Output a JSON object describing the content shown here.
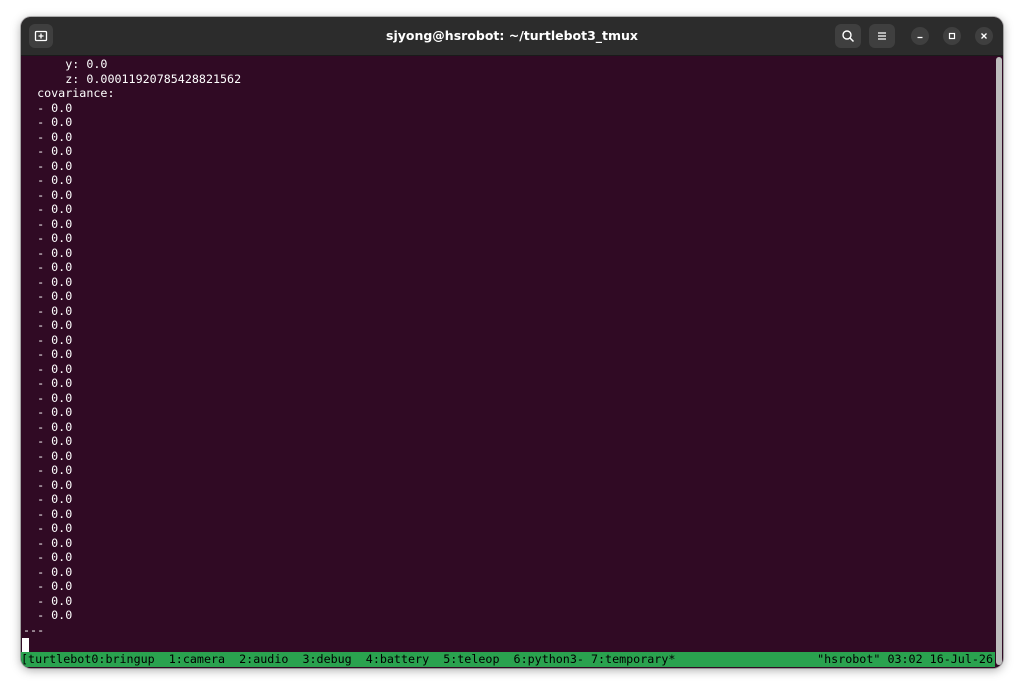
{
  "window": {
    "title": "sjyong@hsrobot: ~/turtlebot3_tmux"
  },
  "icons": {
    "new_tab": "new-tab-icon",
    "search": "search-icon",
    "menu": "hamburger-menu-icon",
    "minimize": "minimize-icon",
    "maximize": "maximize-icon",
    "close": "close-icon"
  },
  "colors": {
    "terminal_bg": "#300a24",
    "titlebar_bg": "#2c2c2c",
    "status_bg": "#2aa24f"
  },
  "terminal": {
    "lines": [
      "      y: 0.0",
      "      z: 0.00011920785428821562",
      "  covariance:",
      "  - 0.0",
      "  - 0.0",
      "  - 0.0",
      "  - 0.0",
      "  - 0.0",
      "  - 0.0",
      "  - 0.0",
      "  - 0.0",
      "  - 0.0",
      "  - 0.0",
      "  - 0.0",
      "  - 0.0",
      "  - 0.0",
      "  - 0.0",
      "  - 0.0",
      "  - 0.0",
      "  - 0.0",
      "  - 0.0",
      "  - 0.0",
      "  - 0.0",
      "  - 0.0",
      "  - 0.0",
      "  - 0.0",
      "  - 0.0",
      "  - 0.0",
      "  - 0.0",
      "  - 0.0",
      "  - 0.0",
      "  - 0.0",
      "  - 0.0",
      "  - 0.0",
      "  - 0.0",
      "  - 0.0",
      "  - 0.0",
      "  - 0.0",
      "  - 0.0",
      "---"
    ]
  },
  "tmux": {
    "left": "[turtlebot0:bringup  1:camera  2:audio  3:debug  4:battery  5:teleop  6:python3- 7:temporary*",
    "right": "\"hsrobot\" 03:02 16-Jul-26"
  }
}
